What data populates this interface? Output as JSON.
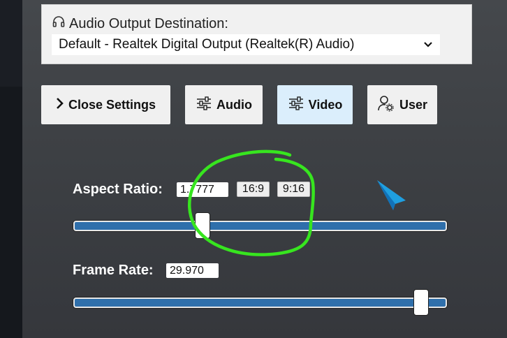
{
  "audio_output": {
    "label": "Audio Output Destination:",
    "selected": "Default - Realtek Digital Output (Realtek(R) Audio)",
    "icon": "headphones-icon"
  },
  "tabs": [
    {
      "label": "Close Settings",
      "icon": "chevron-right-icon"
    },
    {
      "label": "Audio",
      "icon": "sliders-icon"
    },
    {
      "label": "Video",
      "icon": "sliders-icon",
      "active": true
    },
    {
      "label": "User",
      "icon": "user-gear-icon"
    }
  ],
  "aspect_ratio": {
    "label": "Aspect Ratio:",
    "value": "1.7777",
    "presets": [
      "16:9",
      "9:16"
    ],
    "slider_fraction": 0.34
  },
  "frame_rate": {
    "label": "Frame Rate:",
    "value": "29.970",
    "slider_fraction": 0.95
  },
  "colors": {
    "accent": "#2f6fab",
    "active_tab": "#dbeefc",
    "annotation": "#37e51f",
    "cursor": "#1f9fe0"
  }
}
